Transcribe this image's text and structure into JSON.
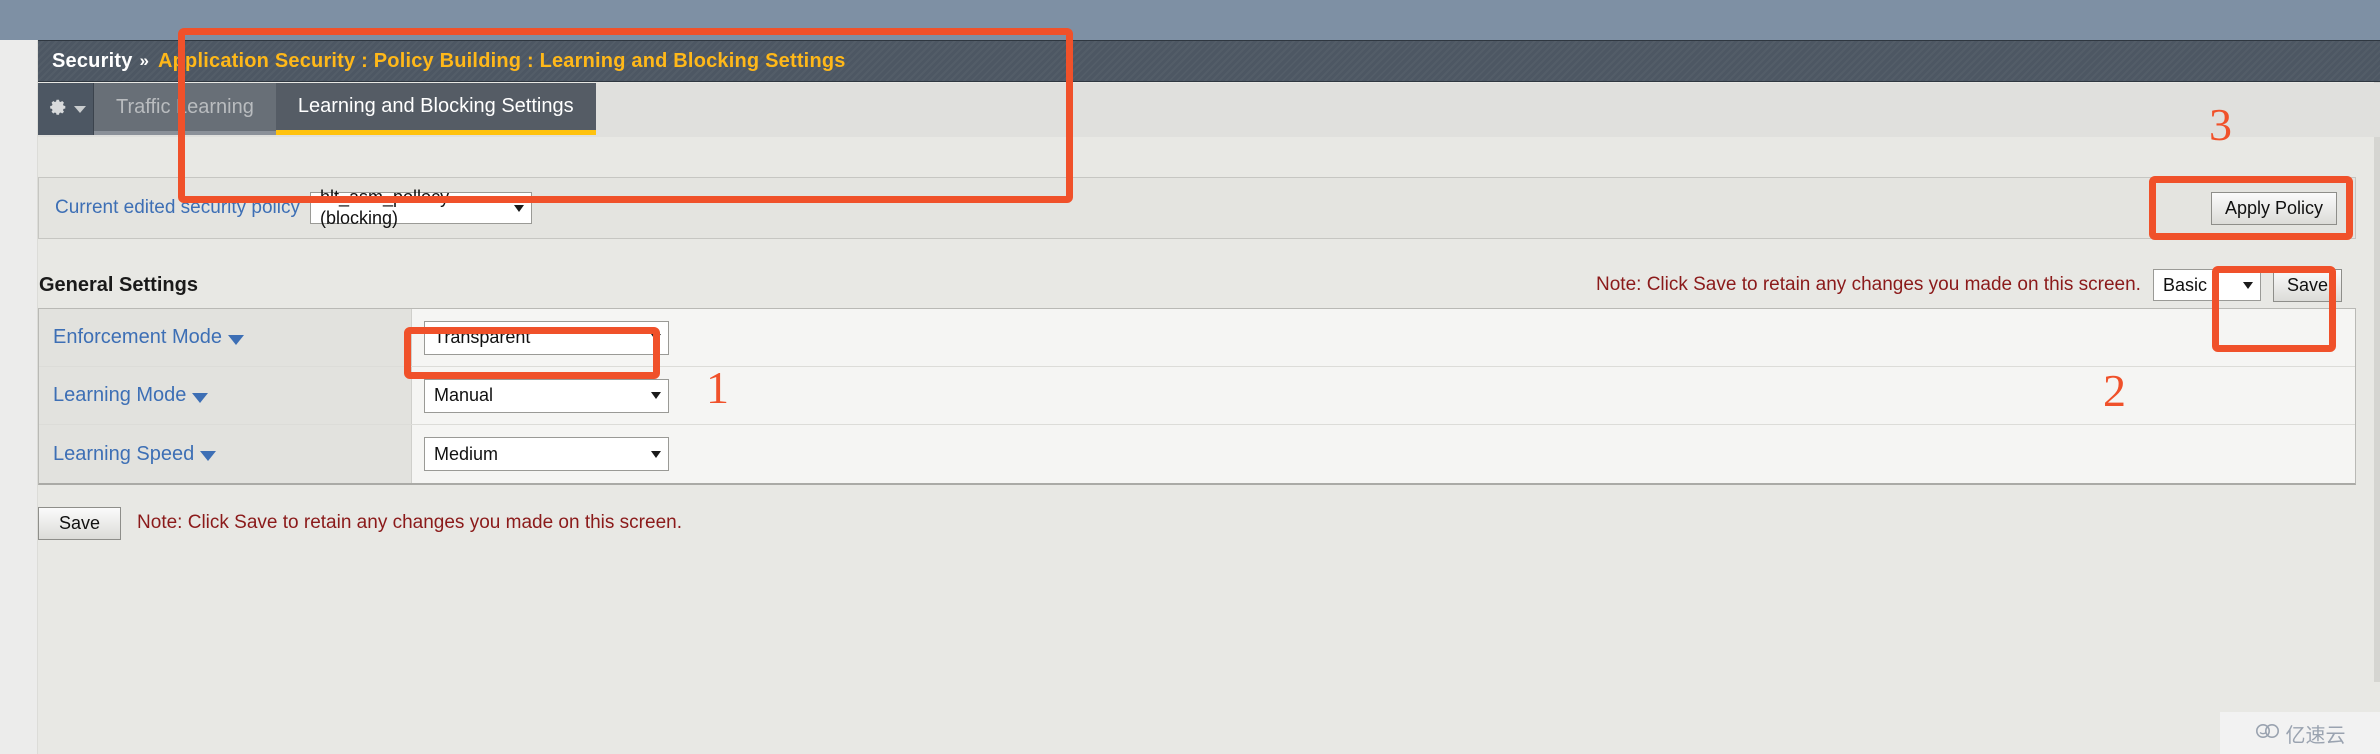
{
  "breadcrumb": {
    "root": "Security",
    "separator": "»",
    "current": "Application Security : Policy Building : Learning and Blocking Settings"
  },
  "tabs": {
    "gear_icon": "gear-icon",
    "gear_caret_icon": "chevron-down-icon",
    "items": [
      {
        "label": "Traffic Learning",
        "active": false
      },
      {
        "label": "Learning and Blocking Settings",
        "active": true
      }
    ]
  },
  "policy_bar": {
    "label": "Current edited security policy",
    "selected_policy": "hlt_asm_pollocy (blocking)",
    "apply_policy_label": "Apply Policy"
  },
  "general_settings": {
    "title": "General Settings",
    "note": "Note: Click Save to retain any changes you made on this screen.",
    "view_mode": "Basic",
    "save_label": "Save",
    "rows": [
      {
        "label": "Enforcement Mode",
        "value": "Transparent"
      },
      {
        "label": "Learning Mode",
        "value": "Manual"
      },
      {
        "label": "Learning Speed",
        "value": "Medium"
      }
    ]
  },
  "bottom_bar": {
    "save_label": "Save",
    "note": "Note: Click Save to retain any changes you made on this screen."
  },
  "annotations": {
    "color": "#f0512a",
    "markers": [
      {
        "id": "1",
        "label": "1"
      },
      {
        "id": "2",
        "label": "2"
      },
      {
        "id": "3",
        "label": "3"
      }
    ]
  },
  "watermark": {
    "text": "亿速云",
    "icon": "cloud-icon"
  }
}
